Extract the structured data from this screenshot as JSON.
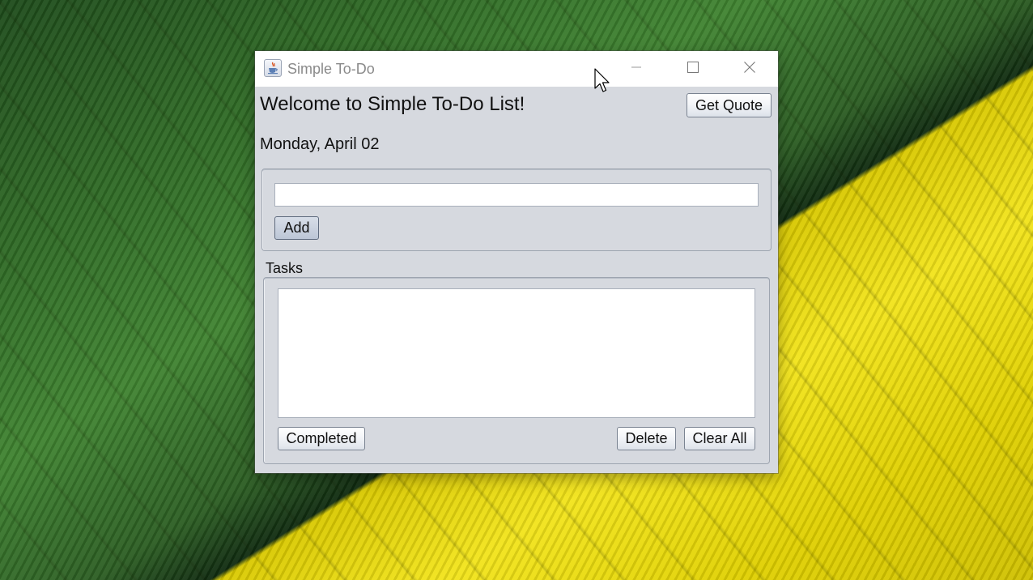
{
  "window": {
    "title": "Simple To-Do"
  },
  "header": {
    "welcome": "Welcome to Simple To-Do List!",
    "date": "Monday, April 02",
    "get_quote_label": "Get Quote"
  },
  "input_panel": {
    "task_value": "",
    "add_label": "Add"
  },
  "tasks_panel": {
    "title": "Tasks",
    "items": [],
    "completed_label": "Completed",
    "delete_label": "Delete",
    "clear_all_label": "Clear All"
  },
  "icons": {
    "app": "java-cup-icon",
    "minimize": "minimize-icon",
    "maximize": "maximize-icon",
    "close": "close-icon",
    "cursor": "mouse-pointer-icon"
  },
  "colors": {
    "window_bg": "#d6d9df",
    "titlebar_bg": "#ffffff",
    "title_text": "#8a8a8a"
  }
}
